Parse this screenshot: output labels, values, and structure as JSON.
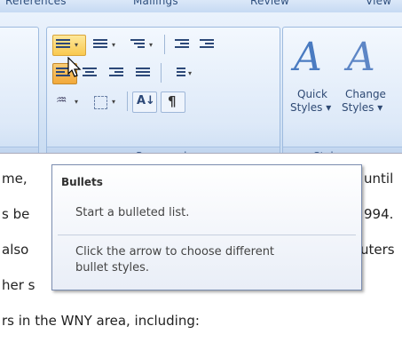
{
  "ribbon_tabs": [
    "References",
    "Mailings",
    "Review",
    "View"
  ],
  "paragraph_group": {
    "label": "Paragraph",
    "pilcrow_glyph": "¶",
    "sort_glyph": "A↓"
  },
  "styles_group": {
    "label": "Styles",
    "quick_styles": {
      "line1": "Quick",
      "line2": "Styles ▾",
      "glyph": "A"
    },
    "change_styles": {
      "line1": "Change",
      "line2": "Styles ▾",
      "glyph": "A"
    }
  },
  "tooltip": {
    "title": "Bullets",
    "line1": "Start a bulleted list.",
    "line2": "Click the arrow to choose different",
    "line3": "bullet styles."
  },
  "document": {
    "lines": [
      {
        "left": "me,",
        "right": "until"
      },
      {
        "left": "s be",
        "right": "994."
      },
      {
        "left": "also",
        "right": "uters"
      },
      {
        "left": "her s",
        "right": ""
      },
      {
        "left": "rs in the WNY area, including:",
        "right": ""
      }
    ]
  },
  "colors": {
    "ribbon": "#dbe8f7",
    "highlight": "#f9c94f",
    "accent": "#4a7bc1"
  }
}
